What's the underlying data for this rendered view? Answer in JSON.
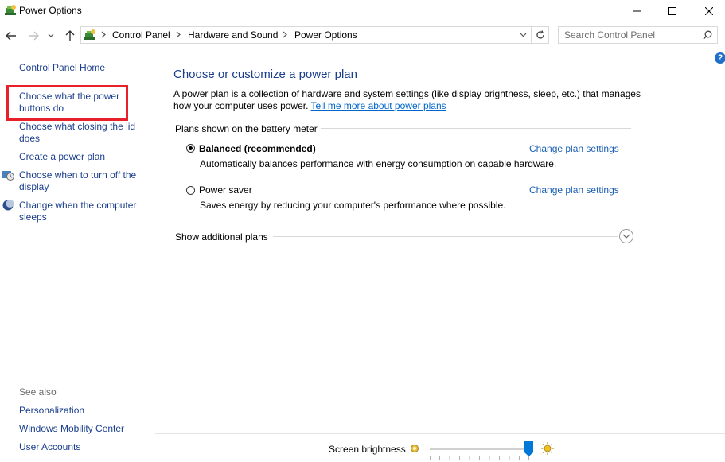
{
  "window": {
    "title": "Power Options",
    "icon": "power-options-icon"
  },
  "addressbar": {
    "crumbs": [
      "Control Panel",
      "Hardware and Sound",
      "Power Options"
    ],
    "search_placeholder": "Search Control Panel"
  },
  "sidebar": {
    "home": "Control Panel Home",
    "links": [
      "Choose what the power buttons do",
      "Choose what closing the lid does",
      "Create a power plan",
      "Choose when to turn off the display",
      "Change when the computer sleeps"
    ],
    "see_also_label": "See also",
    "see_also": [
      "Personalization",
      "Windows Mobility Center",
      "User Accounts"
    ]
  },
  "main": {
    "title": "Choose or customize a power plan",
    "description": "A power plan is a collection of hardware and system settings (like display brightness, sleep, etc.) that manages how your computer uses power.",
    "learn_more": "Tell me more about power plans",
    "group_label": "Plans shown on the battery meter",
    "plans": [
      {
        "name": "Balanced (recommended)",
        "description": "Automatically balances performance with energy consumption on capable hardware.",
        "link": "Change plan settings",
        "selected": true
      },
      {
        "name": "Power saver",
        "description": "Saves energy by reducing your computer's performance where possible.",
        "link": "Change plan settings",
        "selected": false
      }
    ],
    "show_more": "Show additional plans"
  },
  "footer": {
    "brightness_label": "Screen brightness:",
    "brightness_level": 1.0
  },
  "colors": {
    "link": "#1a3e8c",
    "highlight": "#e8202a",
    "accent": "#0078d7"
  }
}
